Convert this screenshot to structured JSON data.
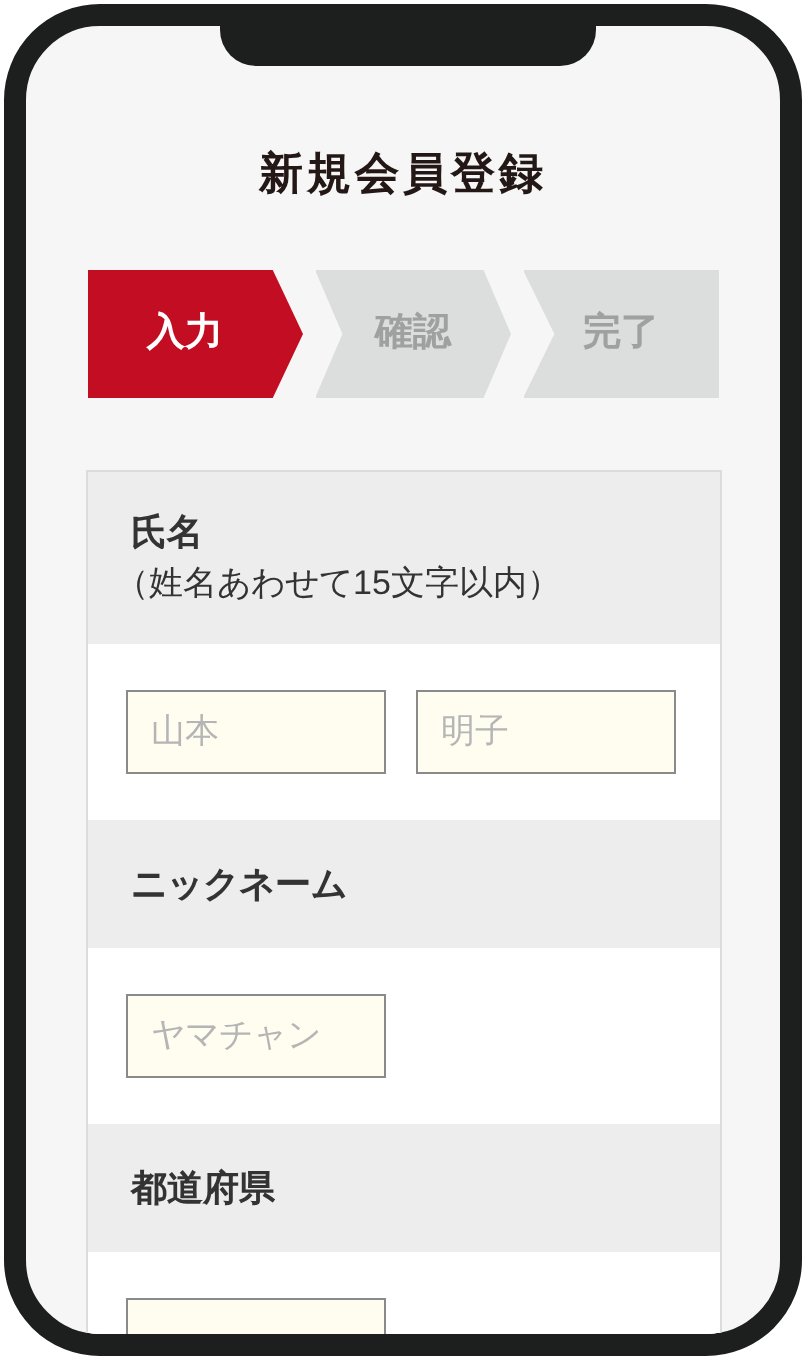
{
  "title": "新規会員登録",
  "steps": [
    {
      "label": "入力",
      "selected": true
    },
    {
      "label": "確認",
      "selected": false
    },
    {
      "label": "完了",
      "selected": false
    }
  ],
  "sections": [
    {
      "label": "氏名",
      "note": "（姓名あわせて15文字以内）",
      "fields": [
        {
          "kind": "text",
          "placeholder": "山本"
        },
        {
          "kind": "text",
          "placeholder": "明子"
        }
      ]
    },
    {
      "label": "ニックネーム",
      "fields": [
        {
          "kind": "text",
          "placeholder": "ヤマチャン"
        }
      ]
    },
    {
      "label": "都道府県",
      "fields": [
        {
          "kind": "text"
        }
      ]
    }
  ]
}
